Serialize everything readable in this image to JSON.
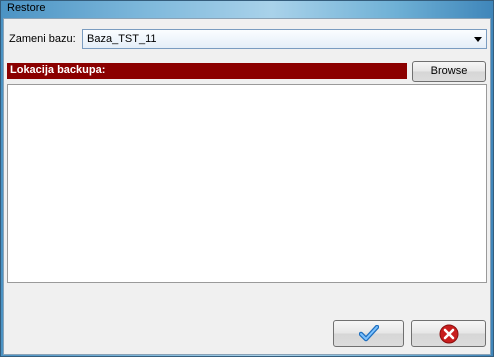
{
  "window": {
    "title": "Restore"
  },
  "form": {
    "database_label": "Zameni bazu:",
    "database_value": "Baza_TST_11",
    "location_banner": "Lokacija backupa:",
    "browse_label": "Browse",
    "location_text": ""
  },
  "actions": {
    "ok_icon": "checkmark-icon",
    "cancel_icon": "close-circle-icon"
  },
  "colors": {
    "banner": "#8b0000",
    "ok_icon": "#3a8fd8",
    "cancel_icon": "#c81e1e"
  }
}
